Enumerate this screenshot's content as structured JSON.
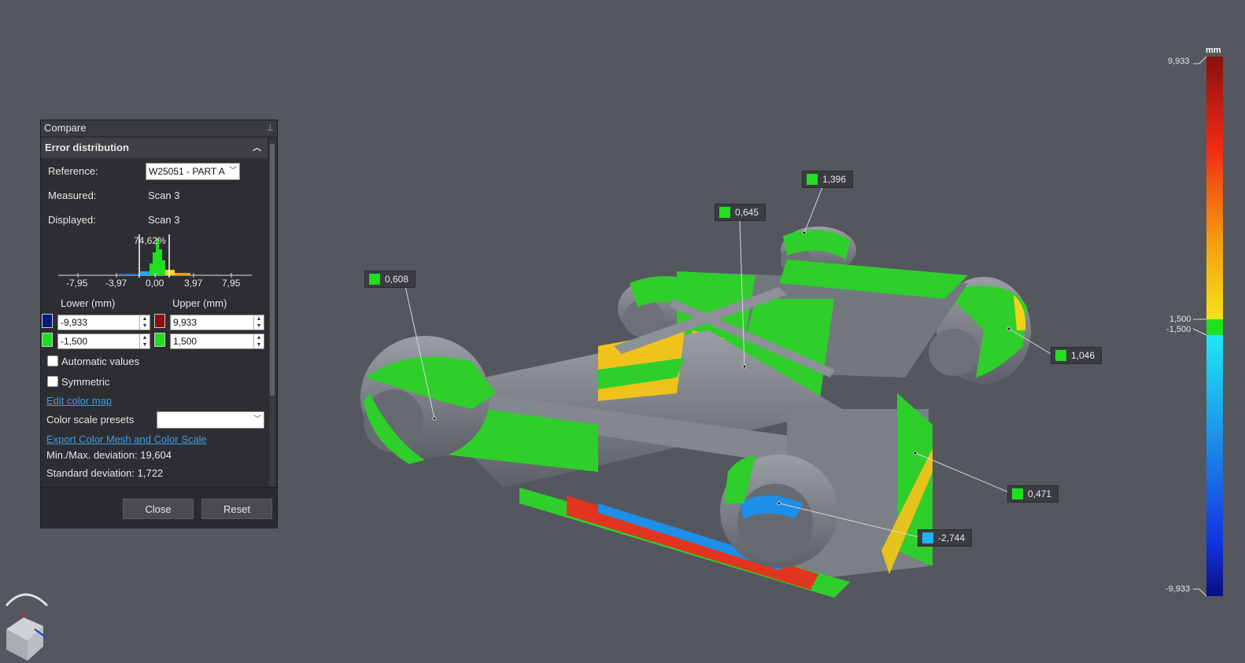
{
  "panel": {
    "title": "Compare",
    "section": "Error distribution",
    "reference_label": "Reference:",
    "reference_value": "W25051 - PART A",
    "measured_label": "Measured:",
    "measured_value": "Scan 3",
    "displayed_label": "Displayed:",
    "displayed_value": "Scan 3",
    "histogram": {
      "peak_percent": "74,62%",
      "ticks": [
        "-7,95",
        "-3,97",
        "0,00",
        "3,97",
        "7,95"
      ]
    },
    "lower_label": "Lower (mm)",
    "upper_label": "Upper (mm)",
    "lower_outer": "-9,933",
    "upper_outer": "9,933",
    "lower_inner": "-1,500",
    "upper_inner": "1,500",
    "automatic_values": "Automatic values",
    "symmetric": "Symmetric",
    "edit_color_map": "Edit color map",
    "color_scale_presets": "Color scale presets",
    "export_link": "Export Color Mesh and Color Scale",
    "minmax": "Min./Max. deviation: 19,604",
    "stddev": "Standard deviation: 1,722",
    "close": "Close",
    "reset": "Reset"
  },
  "colors": {
    "lower_outer": "#001a80",
    "upper_outer": "#8a0f0f",
    "in_tolerance": "#1fe01f",
    "negative": "#1fb4f5"
  },
  "callouts": [
    {
      "value": "1,396",
      "color": "#1fe01f"
    },
    {
      "value": "0,645",
      "color": "#1fe01f"
    },
    {
      "value": "0,608",
      "color": "#1fe01f"
    },
    {
      "value": "1,046",
      "color": "#1fe01f"
    },
    {
      "value": "0,471",
      "color": "#1fe01f"
    },
    {
      "value": "-2,744",
      "color": "#1fb4f5"
    }
  ],
  "color_scale": {
    "unit": "mm",
    "max": "9,933",
    "upper_tol": "1,500",
    "lower_tol": "-1,500",
    "min": "-9,933"
  }
}
